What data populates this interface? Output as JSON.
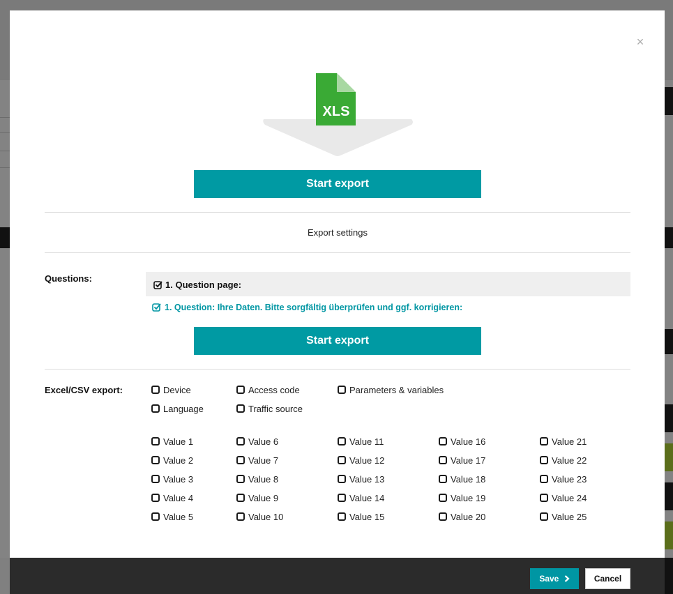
{
  "dialog": {
    "close_glyph": "×",
    "file_icon_label": "XLS",
    "start_export_label": "Start export",
    "export_settings_label": "Export settings"
  },
  "questions": {
    "label": "Questions:",
    "page_title": "1. Question page:",
    "question_text": "1. Question: Ihre Daten. Bitte sorgfältig überprüfen und ggf. korrigieren:"
  },
  "excel_export": {
    "label": "Excel/CSV export:",
    "options_row1": [
      "Device",
      "Access code",
      "Parameters & variables"
    ],
    "options_row2": [
      "Language",
      "Traffic source"
    ],
    "value_columns": [
      [
        "Value 1",
        "Value 2",
        "Value 3",
        "Value 4",
        "Value 5"
      ],
      [
        "Value 6",
        "Value 7",
        "Value 8",
        "Value 9",
        "Value 10"
      ],
      [
        "Value 11",
        "Value 12",
        "Value 13",
        "Value 14",
        "Value 15"
      ],
      [
        "Value 16",
        "Value 17",
        "Value 18",
        "Value 19",
        "Value 20"
      ],
      [
        "Value 21",
        "Value 22",
        "Value 23",
        "Value 24",
        "Value 25"
      ]
    ]
  },
  "footer": {
    "save_label": "Save",
    "cancel_label": "Cancel"
  },
  "colors": {
    "accent": "#009aa3",
    "file_green": "#3aaa35",
    "footer_bg": "#2b2b2b"
  },
  "icons": {
    "close": "close-icon",
    "file": "xls-file-icon",
    "checked": "checked-box-icon",
    "save_chevron": "chevron-right-icon"
  }
}
